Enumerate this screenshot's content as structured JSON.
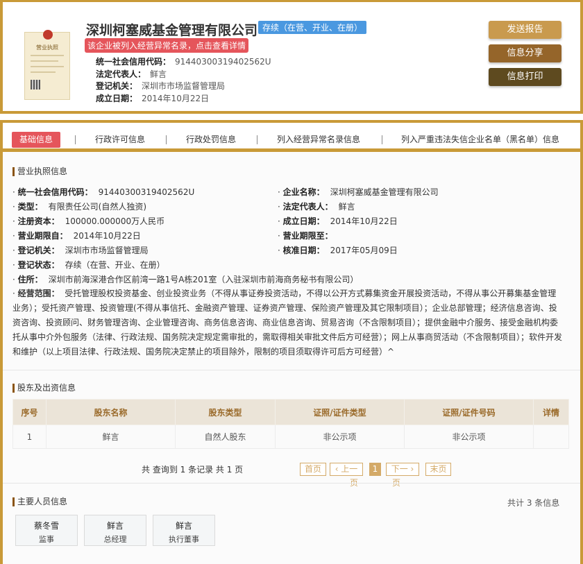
{
  "header": {
    "company_name": "深圳柯塞威基金管理有限公司",
    "status_badge": "存续（在营、开业、在册）",
    "warning": "该企业被列入经营异常名录，点击查看详情",
    "license_image_text": "营业执照",
    "fields": [
      {
        "label": "统一社会信用代码：",
        "value": "91440300319402562U"
      },
      {
        "label": "法定代表人：",
        "value": "鲜言"
      },
      {
        "label": "登记机关：",
        "value": "深圳市市场监督管理局"
      },
      {
        "label": "成立日期：",
        "value": "2014年10月22日"
      }
    ],
    "buttons": {
      "send_report": "发送报告",
      "share": "信息分享",
      "print": "信息打印"
    },
    "colors": {
      "send": "#c99a4e",
      "share": "#95652a",
      "print": "#5e4a1f"
    }
  },
  "tabs": [
    {
      "label": "基础信息"
    },
    {
      "label": "行政许可信息"
    },
    {
      "label": "行政处罚信息"
    },
    {
      "label": "列入经营异常名录信息"
    },
    {
      "label": "列入严重违法失信企业名单（黑名单）信息"
    }
  ],
  "license_info": {
    "title": "营业执照信息",
    "fields": [
      {
        "label": "统一社会信用代码：",
        "value": "91440300319402562U"
      },
      {
        "label": "企业名称：",
        "value": "深圳柯塞威基金管理有限公司"
      },
      {
        "label": "类型：",
        "value": "有限责任公司(自然人独资)"
      },
      {
        "label": "法定代表人：",
        "value": "鲜言"
      },
      {
        "label": "注册资本：",
        "value": "100000.000000万人民币"
      },
      {
        "label": "成立日期：",
        "value": "2014年10月22日"
      },
      {
        "label": "营业期限自：",
        "value": "2014年10月22日"
      },
      {
        "label": "营业期限至：",
        "value": ""
      },
      {
        "label": "登记机关：",
        "value": "深圳市市场监督管理局"
      },
      {
        "label": "核准日期：",
        "value": "2017年05月09日"
      },
      {
        "label": "登记状态：",
        "value": "存续（在营、开业、在册）"
      },
      {
        "label": "住所：",
        "value": "深圳市前海深港合作区前湾一路1号A栋201室（入驻深圳市前海商务秘书有限公司）"
      }
    ],
    "scope_label": "经营范围：",
    "scope_value": "受托管理股权投资基金、创业投资业务（不得从事证券投资活动，不得以公开方式募集资金开展投资活动，不得从事公开募集基金管理业务）；受托资产管理、投资管理(不得从事信托、金融资产管理、证券资产管理、保险资产管理及其它限制项目）；企业总部管理；经济信息咨询、投资咨询、投资顾问、财务管理咨询、企业管理咨询、商务信息咨询、商业信息咨询、贸易咨询（不含限制项目）；提供金融中介服务、接受金融机构委托从事中介外包服务（法律、行政法规、国务院决定规定需审批的，需取得相关审批文件后方可经营）；网上从事商贸活动（不含限制项目）；软件开发和维护（以上项目法律、行政法规、国务院决定禁止的项目除外，限制的项目须取得许可后方可经营）^"
  },
  "shareholders": {
    "title": "股东及出资信息",
    "columns": [
      "序号",
      "股东名称",
      "股东类型",
      "证照/证件类型",
      "证照/证件号码",
      "详情"
    ],
    "rows": [
      [
        "1",
        "鲜言",
        "自然人股东",
        "非公示项",
        "非公示项",
        ""
      ]
    ],
    "pagination": {
      "summary": "共 查询到 1 条记录 共 1 页",
      "first": "首页",
      "prev": "‹ 上一",
      "prev_wrap": "页",
      "current": "1",
      "next": "下一 ›",
      "next_wrap": "页",
      "last": "末页"
    }
  },
  "personnel": {
    "title": "主要人员信息",
    "count": "共计 3 条信息",
    "people": [
      {
        "name": "蔡冬雪",
        "role": "监事"
      },
      {
        "name": "鲜言",
        "role": "总经理"
      },
      {
        "name": "鲜言",
        "role": "执行董事"
      }
    ]
  }
}
